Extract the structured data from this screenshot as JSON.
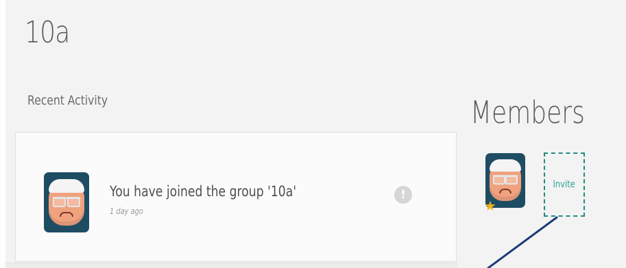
{
  "group": {
    "title": "10a"
  },
  "activity": {
    "heading": "Recent Activity",
    "items": [
      {
        "message": "You have joined the group '10a'",
        "time": "1 day ago",
        "icon": "exclamation-icon"
      }
    ]
  },
  "members": {
    "heading": "Members",
    "invite_label": "Invite",
    "star_icon": "star-icon"
  },
  "colors": {
    "accent": "#2fa39a",
    "avatar_bg": "#1e4d63",
    "star": "#f2b31b",
    "annotation_line": "#1c3a78"
  }
}
